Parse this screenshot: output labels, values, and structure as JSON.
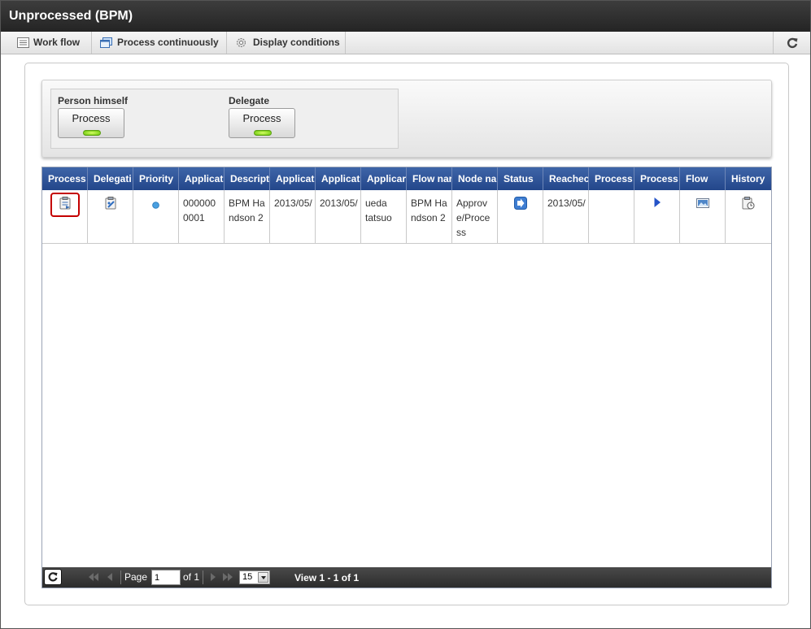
{
  "title": "Unprocessed (BPM)",
  "toolbar": {
    "workflow": "Work flow",
    "process_continuously": "Process continuously",
    "display_conditions": "Display conditions"
  },
  "process_panel": {
    "person_label": "Person himself",
    "person_button": "Process",
    "delegate_label": "Delegate",
    "delegate_button": "Process"
  },
  "grid": {
    "columns": [
      "Process",
      "Delegati",
      "Priority",
      "Applicat",
      "Descript",
      "Applicat",
      "Applicat",
      "Applicar",
      "Flow nar",
      "Node na",
      "Status",
      "Reachec",
      "Process",
      "Process",
      "Flow",
      "History"
    ],
    "row": {
      "application_no": "0000000001",
      "description": "BPM Handson 2",
      "date1": "2013/05/",
      "date2": "2013/05/",
      "applicant": "ueda tatsuo",
      "flow_name": "BPM Handson 2",
      "node_name": "Approve/Process",
      "reached": "2013/05/"
    }
  },
  "pager": {
    "page_label": "Page",
    "page_value": "1",
    "of_label": "of 1",
    "page_size": "15",
    "view_text": "View 1 - 1 of 1"
  },
  "colors": {
    "header_blue": "#2c4f93",
    "highlight_red": "#c40000",
    "led_green": "#62c300"
  }
}
